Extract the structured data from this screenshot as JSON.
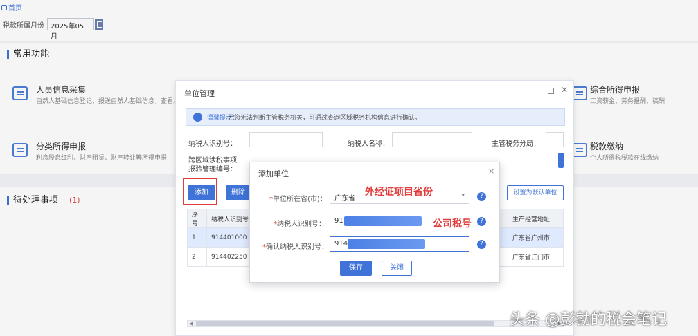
{
  "header": {
    "home_label": "首页",
    "period_label": "税款所属月份",
    "period_value": "2025年05月"
  },
  "common": {
    "title": "常用功能",
    "items": [
      {
        "title": "人员信息采集",
        "desc": "自然人基础信息登记，报送自然人基础信息，查看人员登记"
      },
      {
        "title": "分类所得申报",
        "desc": "利息股息红利、财产租赁、财产转让等所得申报"
      },
      {
        "title": "综合所得申报",
        "desc": "工资薪金、劳务报酬、稿酬"
      },
      {
        "title": "税款缴纳",
        "desc": "个人所得税税款在线缴纳"
      }
    ]
  },
  "pending": {
    "title": "待处理事项",
    "count": "(1)"
  },
  "unit_dialog": {
    "title": "单位管理",
    "tip_label": "温馨提示：",
    "tip_text": "若您无法判断主管税务机关，可通过查询区域税务机构信息进行确认。",
    "fields": {
      "taxpayer_id": "纳税人识别号：",
      "taxpayer_name": "纳税人名称：",
      "tax_office": "主管税务分局：",
      "cross_region": "跨区域涉税事项",
      "report_no": "报验管理编号："
    },
    "add_label": "添加",
    "delete_label": "删除",
    "set_default_label": "设置为默认单位",
    "table": {
      "headers": [
        "序号",
        "纳税人识别号",
        "生产经营地址"
      ],
      "rows": [
        {
          "no": "1",
          "id": "914401000",
          "addr": "广东省广州市"
        },
        {
          "no": "2",
          "id": "914402250",
          "addr": "广东省江门市"
        }
      ]
    }
  },
  "add_dialog": {
    "title": "添加单位",
    "province_label": "单位所在省(市)：",
    "province_value": "广东省",
    "id_label": "纳税人识别号：",
    "id_value": "91",
    "confirm_label": "确认纳税人识别号：",
    "confirm_value": "914",
    "save_label": "保存",
    "close_label": "关闭"
  },
  "annotations": {
    "province": "外经证项目省份",
    "tax_id": "公司税号"
  },
  "watermark": "头条 @彭勃的税会笔记"
}
